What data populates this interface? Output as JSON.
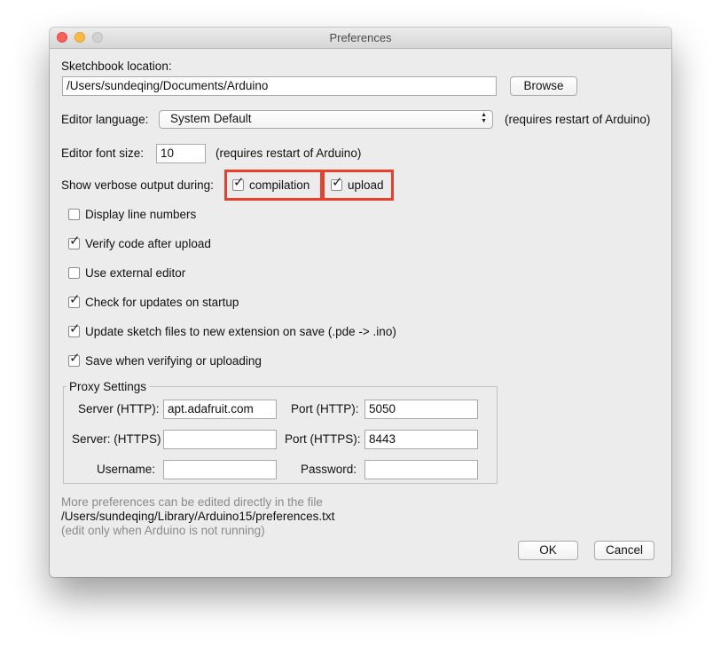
{
  "window": {
    "title": "Preferences",
    "controls": [
      "close",
      "minimize",
      "zoom"
    ]
  },
  "sketchbook": {
    "label": "Sketchbook location:",
    "path": "/Users/sundeqing/Documents/Arduino",
    "browse_label": "Browse"
  },
  "editor_language": {
    "label": "Editor language:",
    "selected": "System Default",
    "note": "(requires restart of Arduino)"
  },
  "font_size": {
    "label": "Editor font size:",
    "value": "10",
    "note": "(requires restart of Arduino)"
  },
  "verbose": {
    "label": "Show verbose output during:",
    "compilation_label": "compilation",
    "compilation_checked": true,
    "upload_label": "upload",
    "upload_checked": true
  },
  "options": [
    {
      "label": "Display line numbers",
      "checked": false
    },
    {
      "label": "Verify code after upload",
      "checked": true
    },
    {
      "label": "Use external editor",
      "checked": false
    },
    {
      "label": "Check for updates on startup",
      "checked": true
    },
    {
      "label": "Update sketch files to new extension on save (.pde -> .ino)",
      "checked": true
    },
    {
      "label": "Save when verifying or uploading",
      "checked": true
    }
  ],
  "proxy": {
    "title": "Proxy Settings",
    "server_http_label": "Server (HTTP):",
    "server_http_value": "apt.adafruit.com",
    "port_http_label": "Port (HTTP):",
    "port_http_value": "5050",
    "server_https_label": "Server: (HTTPS)",
    "server_https_value": "",
    "port_https_label": "Port (HTTPS):",
    "port_https_value": "8443",
    "username_label": "Username:",
    "username_value": "",
    "password_label": "Password:",
    "password_value": ""
  },
  "footer": {
    "more_prefs": "More preferences can be edited directly in the file",
    "prefs_path": "/Users/sundeqing/Library/Arduino15/preferences.txt",
    "edit_note": "(edit only when Arduino is not running)",
    "ok_label": "OK",
    "cancel_label": "Cancel"
  },
  "colors": {
    "highlight": "#e8402a",
    "window_bg": "#ececec"
  }
}
